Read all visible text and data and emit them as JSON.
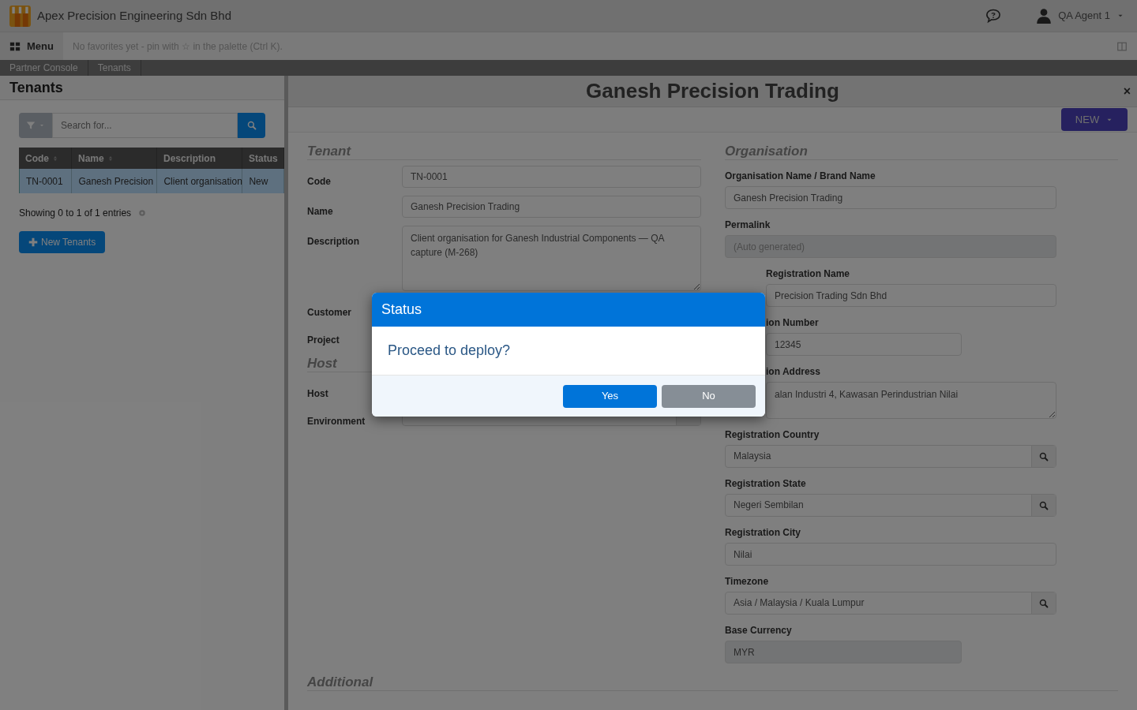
{
  "app": {
    "company": "Apex Precision Engineering Sdn Bhd",
    "user": "QA Agent 1"
  },
  "favorites_bar": {
    "menu": "Menu",
    "hint": "No favorites yet - pin with ☆ in the palette (Ctrl K)."
  },
  "breadcrumbs": [
    "Partner Console",
    "Tenants"
  ],
  "list_panel": {
    "title": "Tenants",
    "search": {
      "placeholder": "Search for..."
    },
    "table": {
      "columns": [
        {
          "label": "Code",
          "sortable": true
        },
        {
          "label": "Name",
          "sortable": true
        },
        {
          "label": "Description",
          "sortable": false
        },
        {
          "label": "Status"
        }
      ],
      "rows": [
        {
          "cells": [
            "TN-0001",
            "Ganesh Precision",
            "Client organisation",
            "New"
          ],
          "selected": true
        }
      ]
    },
    "footer": "Showing 0 to 1 of 1 entries",
    "new_button": "New Tenants"
  },
  "detail": {
    "title": "Ganesh Precision Trading",
    "close": "×",
    "new_button": "NEW",
    "tenant_section": {
      "heading": "Tenant",
      "fields": [
        {
          "label": "Code",
          "kind": "text",
          "value": "TN-0001"
        },
        {
          "label": "Name",
          "kind": "text",
          "value": "Ganesh Precision Trading"
        },
        {
          "label": "Description",
          "kind": "textarea",
          "value": "Client organisation for Ganesh Industrial Components — QA capture (M-268)"
        },
        {
          "label": "Customer",
          "kind": "label"
        },
        {
          "label": "Project",
          "kind": "label"
        }
      ]
    },
    "host_section": {
      "heading": "Host",
      "fields": [
        {
          "label": "Host",
          "kind": "label"
        },
        {
          "label": "Environment",
          "kind": "lookup"
        }
      ]
    },
    "organisation_section": {
      "heading": "Organisation",
      "fields": [
        {
          "label": "Organisation Name / Brand Name",
          "kind": "text",
          "value": "Ganesh Precision Trading",
          "partly_hidden": false,
          "disabled": false
        },
        {
          "label": "Permalink",
          "kind": "text",
          "placeholder": "(Auto generated)",
          "partly_hidden": false,
          "disabled": true
        },
        {
          "label": "Registration Name",
          "kind": "text",
          "value": "Precision Trading Sdn Bhd",
          "partly_hidden": true,
          "disabled": false
        },
        {
          "label": "ion Number",
          "kind": "short",
          "value": "12345",
          "partly_hidden": true,
          "disabled": false
        },
        {
          "label": "ion Address",
          "kind": "textarea",
          "value": "alan Industri 4, Kawasan Perindustrian Nilai",
          "partly_hidden": true,
          "disabled": false
        },
        {
          "label": "Registration Country",
          "kind": "lookup",
          "value": "Malaysia",
          "partly_hidden": false,
          "disabled": false
        },
        {
          "label": "Registration State",
          "kind": "lookup",
          "value": "Negeri Sembilan",
          "partly_hidden": false,
          "disabled": false
        },
        {
          "label": "Registration City",
          "kind": "text",
          "value": "Nilai",
          "partly_hidden": false,
          "disabled": false
        },
        {
          "label": "Timezone",
          "kind": "lookup",
          "value": "Asia / Malaysia / Kuala Lumpur",
          "partly_hidden": false,
          "disabled": false
        },
        {
          "label": "Base Currency",
          "kind": "short",
          "value": "MYR",
          "partly_hidden": false,
          "disabled": true
        }
      ]
    },
    "additional_section": {
      "heading": "Additional"
    }
  },
  "dialog": {
    "title": "Status",
    "message": "Proceed to deploy?",
    "buttons": [
      {
        "label": "Yes",
        "kind": "primary"
      },
      {
        "label": "No",
        "kind": "secondary"
      }
    ]
  }
}
